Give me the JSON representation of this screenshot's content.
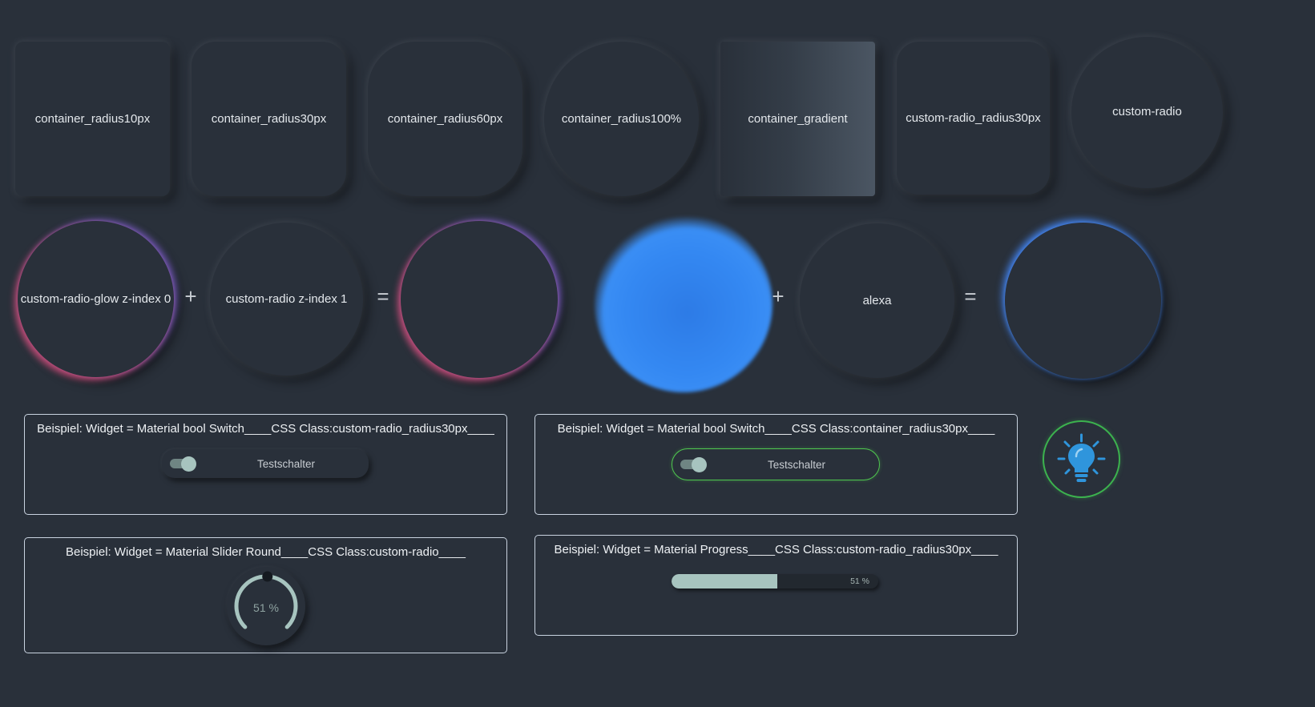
{
  "row1": [
    {
      "label": "container_radius10px"
    },
    {
      "label": "container_radius30px"
    },
    {
      "label": "container_radius60px"
    },
    {
      "label": "container_radius100%"
    },
    {
      "label": "container_gradient"
    },
    {
      "label": "custom-radio_radius30px"
    },
    {
      "label": "custom-radio"
    }
  ],
  "row2": {
    "glow_circle": "custom-radio-glow z-index 0",
    "plus": "+",
    "radio_circle": "custom-radio z-index 1",
    "equals": "=",
    "alexa": "alexa"
  },
  "panels": {
    "switch1": {
      "title": "Beispiel: Widget = Material bool Switch____CSS Class:custom-radio_radius30px____",
      "switch_label": "Testschalter"
    },
    "switch2": {
      "title": "Beispiel: Widget = Material bool Switch____CSS Class:container_radius30px____",
      "switch_label": "Testschalter"
    },
    "slider": {
      "title": "Beispiel: Widget = Material Slider Round____CSS Class:custom-radio____",
      "value_label": "51 %",
      "value": 51
    },
    "progress": {
      "title": "Beispiel: Widget = Material Progress____CSS Class:custom-radio_radius30px____",
      "value_label": "51 %",
      "value": 51
    }
  },
  "colors": {
    "background": "#29303a",
    "accent_teal": "#a7c4bf",
    "green_border": "#4fc64f",
    "bulb_blue": "#2f95dc",
    "glow_blue": "#468cff",
    "glow_pink": "#cd507d"
  },
  "icons": {
    "bulb": "lightbulb-icon"
  }
}
